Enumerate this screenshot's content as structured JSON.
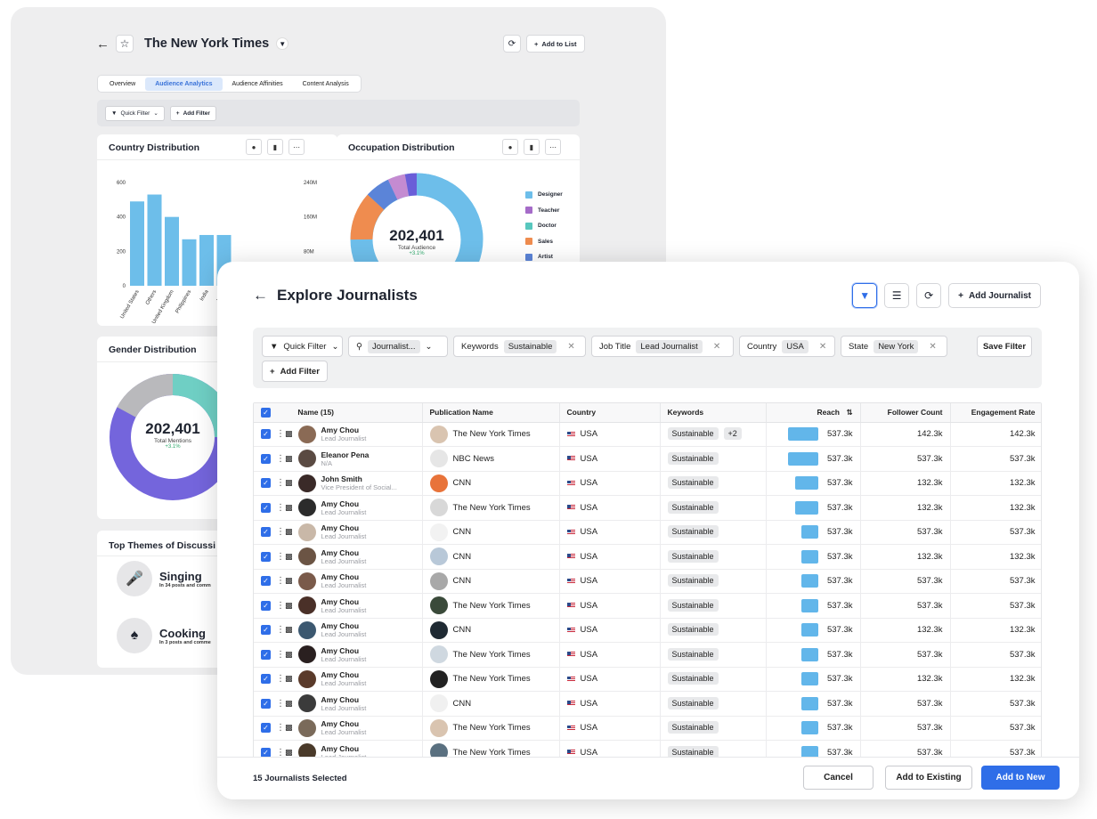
{
  "back": {
    "title": "The New York Times",
    "add_to_list": "Add to List",
    "tabs": [
      "Overview",
      "Audience Analytics",
      "Audience Affinities",
      "Content Analysis"
    ],
    "quick_filter": "Quick Filter",
    "add_filter": "Add Filter",
    "country_card": {
      "title": "Country Distribution",
      "chart_data": {
        "type": "bar",
        "categories": [
          "United States",
          "Others",
          "United Kingdom",
          "Philippines",
          "India",
          "Nig..."
        ],
        "values": [
          490,
          530,
          400,
          270,
          295,
          295
        ],
        "left_axis_ticks": [
          "600",
          "400",
          "200",
          "0"
        ],
        "right_axis_ticks": [
          "240M",
          "160M",
          "80M"
        ],
        "ylim": [
          0,
          600
        ],
        "color": "#6dbeea"
      }
    },
    "occupation_card": {
      "title": "Occupation Distribution",
      "total": "202,401",
      "total_label": "Total Audience",
      "delta": "+3.1%",
      "legend": [
        {
          "label": "Designer",
          "color": "#6dbeea"
        },
        {
          "label": "Teacher",
          "color": "#a56bc8"
        },
        {
          "label": "Doctor",
          "color": "#58c7be"
        },
        {
          "label": "Sales",
          "color": "#ef8c4f"
        },
        {
          "label": "Artist",
          "color": "#5b84d8"
        }
      ]
    },
    "gender_card": {
      "title": "Gender Distribution",
      "total": "202,401",
      "total_label": "Total Mentions",
      "delta": "+3.1%"
    },
    "themes_card": {
      "title": "Top Themes of Discussi",
      "items": [
        {
          "name": "Singing",
          "sub": "In 34 posts and comm"
        },
        {
          "name": "Cooking",
          "sub": "In 3 posts and comme"
        }
      ]
    }
  },
  "front": {
    "title": "Explore Journalists",
    "add_journalist": "Add Journalist",
    "filters": {
      "quick_filter": "Quick Filter",
      "search_value": "Journalist...",
      "keywords_label": "Keywords",
      "keywords_value": "Sustainable",
      "jobtitle_label": "Job Title",
      "jobtitle_value": "Lead Journalist",
      "country_label": "Country",
      "country_value": "USA",
      "state_label": "State",
      "state_value": "New York",
      "save_filter": "Save Filter",
      "add_filter": "Add Filter"
    },
    "columns": [
      "Name (15)",
      "Publication Name",
      "Country",
      "Keywords",
      "Reach",
      "Follower Count",
      "Engagement Rate"
    ],
    "rows": [
      {
        "name": "Amy Chou",
        "role": "Lead Journalist",
        "pub": "The New York Times",
        "country": "USA",
        "kw": "Sustainable",
        "more": "+2",
        "reach": "537.3k",
        "reach_frac": 1.0,
        "followers": "142.3k",
        "eng": "142.3k"
      },
      {
        "name": "Eleanor Pena",
        "role": "N/A",
        "pub": "NBC News",
        "country": "USA",
        "kw": "Sustainable",
        "more": "",
        "reach": "537.3k",
        "reach_frac": 1.0,
        "followers": "537.3k",
        "eng": "537.3k"
      },
      {
        "name": "John Smith",
        "role": "Vice President of Social...",
        "pub": "CNN",
        "country": "USA",
        "kw": "Sustainable",
        "more": "",
        "reach": "537.3k",
        "reach_frac": 0.75,
        "followers": "132.3k",
        "eng": "132.3k"
      },
      {
        "name": "Amy Chou",
        "role": "Lead Journalist",
        "pub": "The New York Times",
        "country": "USA",
        "kw": "Sustainable",
        "more": "",
        "reach": "537.3k",
        "reach_frac": 0.75,
        "followers": "132.3k",
        "eng": "132.3k"
      },
      {
        "name": "Amy Chou",
        "role": "Lead Journalist",
        "pub": "CNN",
        "country": "USA",
        "kw": "Sustainable",
        "more": "",
        "reach": "537.3k",
        "reach_frac": 0.55,
        "followers": "537.3k",
        "eng": "537.3k"
      },
      {
        "name": "Amy Chou",
        "role": "Lead Journalist",
        "pub": "CNN",
        "country": "USA",
        "kw": "Sustainable",
        "more": "",
        "reach": "537.3k",
        "reach_frac": 0.55,
        "followers": "132.3k",
        "eng": "132.3k"
      },
      {
        "name": "Amy Chou",
        "role": "Lead Journalist",
        "pub": "CNN",
        "country": "USA",
        "kw": "Sustainable",
        "more": "",
        "reach": "537.3k",
        "reach_frac": 0.55,
        "followers": "537.3k",
        "eng": "537.3k"
      },
      {
        "name": "Amy Chou",
        "role": "Lead Journalist",
        "pub": "The New York Times",
        "country": "USA",
        "kw": "Sustainable",
        "more": "",
        "reach": "537.3k",
        "reach_frac": 0.55,
        "followers": "537.3k",
        "eng": "537.3k"
      },
      {
        "name": "Amy Chou",
        "role": "Lead Journalist",
        "pub": "CNN",
        "country": "USA",
        "kw": "Sustainable",
        "more": "",
        "reach": "537.3k",
        "reach_frac": 0.55,
        "followers": "132.3k",
        "eng": "132.3k"
      },
      {
        "name": "Amy Chou",
        "role": "Lead Journalist",
        "pub": "The New York Times",
        "country": "USA",
        "kw": "Sustainable",
        "more": "",
        "reach": "537.3k",
        "reach_frac": 0.55,
        "followers": "537.3k",
        "eng": "537.3k"
      },
      {
        "name": "Amy Chou",
        "role": "Lead Journalist",
        "pub": "The New York Times",
        "country": "USA",
        "kw": "Sustainable",
        "more": "",
        "reach": "537.3k",
        "reach_frac": 0.55,
        "followers": "132.3k",
        "eng": "132.3k"
      },
      {
        "name": "Amy Chou",
        "role": "Lead Journalist",
        "pub": "CNN",
        "country": "USA",
        "kw": "Sustainable",
        "more": "",
        "reach": "537.3k",
        "reach_frac": 0.55,
        "followers": "537.3k",
        "eng": "537.3k"
      },
      {
        "name": "Amy Chou",
        "role": "Lead Journalist",
        "pub": "The New York Times",
        "country": "USA",
        "kw": "Sustainable",
        "more": "",
        "reach": "537.3k",
        "reach_frac": 0.55,
        "followers": "537.3k",
        "eng": "537.3k"
      },
      {
        "name": "Amy Chou",
        "role": "Lead Journalist",
        "pub": "The New York Times",
        "country": "USA",
        "kw": "Sustainable",
        "more": "",
        "reach": "537.3k",
        "reach_frac": 0.55,
        "followers": "537.3k",
        "eng": "537.3k"
      }
    ],
    "footer": {
      "selected": "15 Journalists Selected",
      "cancel": "Cancel",
      "add_existing": "Add to Existing",
      "add_new": "Add to New"
    }
  }
}
